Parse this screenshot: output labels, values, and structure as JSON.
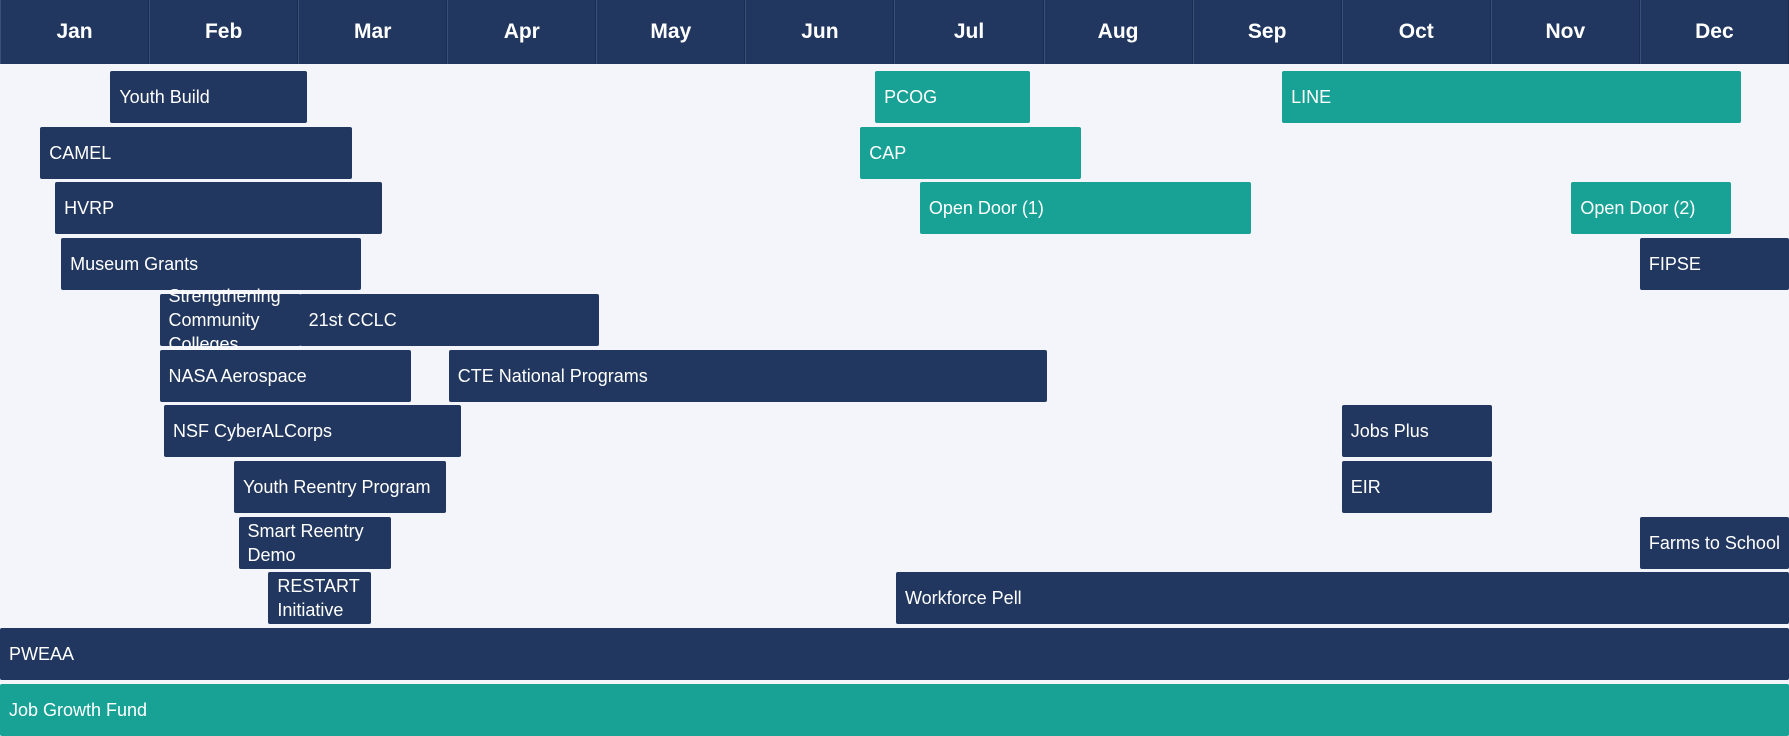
{
  "colors": {
    "navy": "#21375f",
    "teal": "#18a195",
    "background": "#f3f5fb"
  },
  "chart_data": {
    "type": "gantt",
    "months": [
      "Jan",
      "Feb",
      "Mar",
      "Apr",
      "May",
      "Jun",
      "Jul",
      "Aug",
      "Sep",
      "Oct",
      "Nov",
      "Dec"
    ],
    "tasks": [
      {
        "label": "Youth Build",
        "start": 0.74,
        "end": 2.06,
        "row": 0,
        "color": "navy"
      },
      {
        "label": "PCOG",
        "start": 5.87,
        "end": 6.91,
        "row": 0,
        "color": "teal"
      },
      {
        "label": "LINE",
        "start": 8.6,
        "end": 11.68,
        "row": 0,
        "color": "teal"
      },
      {
        "label": "CAMEL",
        "start": 0.27,
        "end": 2.36,
        "row": 1,
        "color": "navy"
      },
      {
        "label": "CAP",
        "start": 5.77,
        "end": 7.25,
        "row": 1,
        "color": "teal"
      },
      {
        "label": "HVRP",
        "start": 0.37,
        "end": 2.56,
        "row": 2,
        "color": "navy"
      },
      {
        "label": "Open Door (1)",
        "start": 6.17,
        "end": 8.39,
        "row": 2,
        "color": "teal"
      },
      {
        "label": "Open Door (2)",
        "start": 10.54,
        "end": 11.61,
        "row": 2,
        "color": "teal"
      },
      {
        "label": "Museum Grants",
        "start": 0.41,
        "end": 2.42,
        "row": 3,
        "color": "navy"
      },
      {
        "label": "FIPSE",
        "start": 11.0,
        "end": 12.0,
        "row": 3,
        "color": "navy"
      },
      {
        "label": "Strengthening Community Colleges",
        "start": 1.07,
        "end": 2.02,
        "row": 4,
        "color": "navy",
        "wrap": true
      },
      {
        "label": "21st CCLC",
        "start": 2.01,
        "end": 4.02,
        "row": 4,
        "color": "navy",
        "above": true
      },
      {
        "label": "NASA Aerospace",
        "start": 1.07,
        "end": 2.76,
        "row": 5,
        "color": "navy"
      },
      {
        "label": "CTE National Programs",
        "start": 3.01,
        "end": 7.02,
        "row": 5,
        "color": "navy"
      },
      {
        "label": "NSF CyberALCorps",
        "start": 1.1,
        "end": 3.09,
        "row": 6,
        "color": "navy"
      },
      {
        "label": "Jobs Plus",
        "start": 9.0,
        "end": 10.01,
        "row": 6,
        "color": "navy"
      },
      {
        "label": "Youth Reentry Program",
        "start": 1.57,
        "end": 2.99,
        "row": 7,
        "color": "navy"
      },
      {
        "label": "EIR",
        "start": 9.0,
        "end": 10.01,
        "row": 7,
        "color": "navy"
      },
      {
        "label": "Smart Reentry Demo",
        "start": 1.6,
        "end": 2.62,
        "row": 8,
        "color": "navy",
        "wrap": true
      },
      {
        "label": "Farms to School",
        "start": 11.0,
        "end": 12.0,
        "row": 8,
        "color": "navy"
      },
      {
        "label": "RESTART Initiative",
        "start": 1.8,
        "end": 2.49,
        "row": 9,
        "color": "navy",
        "wrap": true
      },
      {
        "label": "Workforce Pell",
        "start": 6.01,
        "end": 12.0,
        "row": 9,
        "color": "navy"
      },
      {
        "label": "PWEAA",
        "start": 0.0,
        "end": 12.0,
        "row": 10,
        "color": "navy"
      },
      {
        "label": "Job Growth Fund",
        "start": 0.0,
        "end": 12.0,
        "row": 11,
        "color": "teal"
      }
    ]
  }
}
